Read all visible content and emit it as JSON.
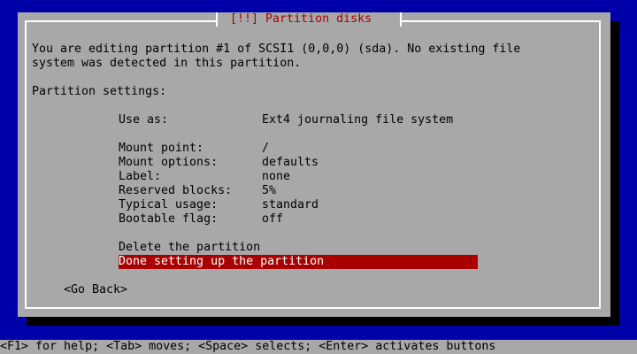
{
  "dialog": {
    "title": "[!!] Partition disks",
    "description": [
      "You are editing partition #1 of SCSI1 (0,0,0) (sda). No existing file",
      "system was detected in this partition."
    ],
    "section_heading": "Partition settings:"
  },
  "settings": [
    {
      "label": "Use as:",
      "value": "Ext4 journaling file system"
    },
    {
      "label": "Mount point:",
      "value": "/"
    },
    {
      "label": "Mount options:",
      "value": "defaults"
    },
    {
      "label": "Label:",
      "value": "none"
    },
    {
      "label": "Reserved blocks:",
      "value": "5%"
    },
    {
      "label": "Typical usage:",
      "value": "standard"
    },
    {
      "label": "Bootable flag:",
      "value": "off"
    }
  ],
  "actions": {
    "delete": "Delete the partition",
    "done": "Done setting up the partition"
  },
  "go_back": "<Go Back>",
  "statusbar": "<F1> for help; <Tab> moves; <Space> selects; <Enter> activates buttons",
  "colors": {
    "background": "#0000a8",
    "dialog": "#a8a8a8",
    "title": "#a80000",
    "selection": "#a80000",
    "selection_text": "#ffffff",
    "frame": "#ffffff"
  }
}
